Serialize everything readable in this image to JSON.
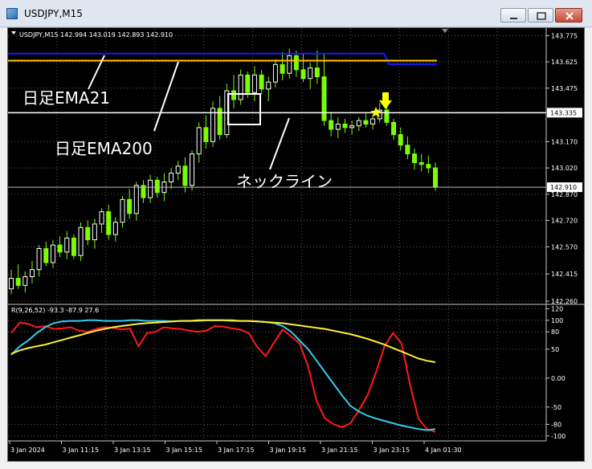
{
  "window": {
    "title": "USDJPY,M15"
  },
  "chart": {
    "header_text": "USDJPY,M15  142.994 143.019 142.893 142.910",
    "price_axis": {
      "labels": [
        "143.775",
        "143.625",
        "143.475",
        "143.170",
        "143.020",
        "142.870",
        "142.720",
        "142.570",
        "142.415",
        "142.260"
      ],
      "values": [
        143.775,
        143.625,
        143.475,
        143.17,
        143.02,
        142.87,
        142.72,
        142.57,
        142.415,
        142.26
      ],
      "range": [
        142.26,
        143.79
      ]
    },
    "neckline_price_label": "143.335",
    "current_price_label": "142.910",
    "annotations": {
      "ema21": "日足EMA21",
      "ema200": "日足EMA200",
      "neckline": "ネックライン"
    },
    "colors": {
      "ema21": "#1a1aff",
      "ema200": "#ffbf00",
      "candle_up": "#ffffff",
      "candle_down": "#7cfc00",
      "neckline": "#ffffff",
      "arrow": "#ffff00"
    },
    "candles": [
      [
        142.33,
        142.44,
        142.3,
        142.39
      ],
      [
        142.39,
        142.47,
        142.33,
        142.35
      ],
      [
        142.35,
        142.43,
        142.31,
        142.4
      ],
      [
        142.4,
        142.49,
        142.36,
        142.44
      ],
      [
        142.44,
        142.58,
        142.4,
        142.56
      ],
      [
        142.56,
        142.6,
        142.46,
        142.48
      ],
      [
        142.48,
        142.61,
        142.45,
        142.58
      ],
      [
        142.58,
        142.63,
        142.51,
        142.54
      ],
      [
        142.54,
        142.66,
        142.5,
        142.62
      ],
      [
        142.62,
        142.64,
        142.5,
        142.52
      ],
      [
        142.52,
        142.71,
        142.49,
        142.68
      ],
      [
        142.68,
        142.72,
        142.58,
        142.61
      ],
      [
        142.61,
        142.73,
        142.56,
        142.7
      ],
      [
        142.7,
        142.79,
        142.65,
        142.77
      ],
      [
        142.77,
        142.81,
        142.61,
        142.64
      ],
      [
        142.64,
        142.74,
        142.6,
        142.71
      ],
      [
        142.71,
        142.86,
        142.68,
        142.84
      ],
      [
        142.84,
        142.9,
        142.73,
        142.76
      ],
      [
        142.76,
        142.94,
        142.72,
        142.92
      ],
      [
        142.92,
        142.95,
        142.82,
        142.85
      ],
      [
        142.85,
        142.98,
        142.82,
        142.95
      ],
      [
        142.95,
        142.97,
        142.85,
        142.88
      ],
      [
        142.88,
        142.99,
        142.83,
        142.94
      ],
      [
        142.94,
        143.02,
        142.9,
        142.99
      ],
      [
        142.99,
        143.06,
        142.95,
        143.03
      ],
      [
        143.03,
        143.08,
        142.88,
        142.92
      ],
      [
        142.92,
        143.12,
        142.89,
        143.1
      ],
      [
        143.1,
        143.28,
        143.05,
        143.25
      ],
      [
        143.25,
        143.32,
        143.13,
        143.17
      ],
      [
        143.17,
        143.4,
        143.14,
        143.36
      ],
      [
        143.36,
        143.43,
        143.18,
        143.21
      ],
      [
        143.21,
        143.5,
        143.19,
        143.46
      ],
      [
        143.46,
        143.55,
        143.36,
        143.41
      ],
      [
        143.41,
        143.58,
        143.38,
        143.55
      ],
      [
        143.55,
        143.57,
        143.42,
        143.45
      ],
      [
        143.45,
        143.6,
        143.4,
        143.55
      ],
      [
        143.55,
        143.58,
        143.44,
        143.47
      ],
      [
        143.47,
        143.54,
        143.4,
        143.51
      ],
      [
        143.51,
        143.64,
        143.48,
        143.61
      ],
      [
        143.61,
        143.68,
        143.52,
        143.56
      ],
      [
        143.56,
        143.7,
        143.53,
        143.66
      ],
      [
        143.66,
        143.69,
        143.54,
        143.58
      ],
      [
        143.58,
        143.67,
        143.51,
        143.53
      ],
      [
        143.53,
        143.62,
        143.47,
        143.59
      ],
      [
        143.59,
        143.69,
        143.5,
        143.54
      ],
      [
        143.54,
        143.67,
        143.26,
        143.29
      ],
      [
        143.29,
        143.34,
        143.2,
        143.24
      ],
      [
        143.24,
        143.31,
        143.19,
        143.27
      ],
      [
        143.27,
        143.3,
        143.22,
        143.25
      ],
      [
        143.25,
        143.29,
        143.21,
        143.26
      ],
      [
        143.26,
        143.31,
        143.23,
        143.29
      ],
      [
        143.29,
        143.33,
        143.25,
        143.27
      ],
      [
        143.27,
        143.31,
        143.24,
        143.3
      ],
      [
        143.3,
        143.39,
        143.28,
        143.35
      ],
      [
        143.35,
        143.37,
        143.26,
        143.28
      ],
      [
        143.28,
        143.3,
        143.18,
        143.21
      ],
      [
        143.21,
        143.25,
        143.12,
        143.15
      ],
      [
        143.15,
        143.2,
        143.07,
        143.1
      ],
      [
        143.1,
        143.13,
        143.01,
        143.05
      ],
      [
        143.05,
        143.1,
        143.0,
        143.04
      ],
      [
        143.04,
        143.09,
        142.99,
        143.02
      ],
      [
        143.02,
        143.05,
        142.89,
        142.91
      ]
    ],
    "ema21_price": 143.672,
    "ema21_after_price": 143.612,
    "ema200_price": 143.632,
    "neckline_price": 143.335,
    "oscillator": {
      "header": "R(9,26,52) -93.3 -87.9 27.6",
      "axis_labels": [
        "120",
        "100",
        "80",
        "50",
        "0.00",
        "-50",
        "-80",
        "-100"
      ],
      "axis_values": [
        120,
        100,
        80,
        50,
        0,
        -50,
        -80,
        -100
      ],
      "range": [
        -103,
        122
      ],
      "series": [
        {
          "name": "red",
          "color": "#ff1a1a",
          "values": [
            78,
            96,
            94,
            88,
            90,
            85,
            86,
            88,
            82,
            80,
            85,
            88,
            87,
            84,
            86,
            55,
            78,
            80,
            88,
            86,
            85,
            82,
            80,
            82,
            90,
            89,
            86,
            84,
            78,
            54,
            38,
            62,
            84,
            72,
            60,
            20,
            -40,
            -70,
            -80,
            -85,
            -78,
            -55,
            -30,
            10,
            55,
            78,
            60,
            -10,
            -70,
            -88,
            -93
          ]
        },
        {
          "name": "cyan",
          "color": "#33ccee",
          "values": [
            40,
            55,
            65,
            78,
            88,
            95,
            98,
            99,
            99,
            100,
            100,
            99,
            99,
            99,
            100,
            100,
            99,
            99,
            99,
            98,
            99,
            99,
            99,
            100,
            100,
            100,
            99,
            99,
            99,
            98,
            97,
            95,
            90,
            80,
            65,
            50,
            30,
            10,
            -10,
            -30,
            -48,
            -58,
            -65,
            -70,
            -74,
            -78,
            -82,
            -85,
            -88,
            -90,
            -88
          ]
        },
        {
          "name": "yellow",
          "color": "#ffee33",
          "values": [
            42,
            48,
            52,
            55,
            58,
            62,
            66,
            70,
            74,
            78,
            82,
            85,
            88,
            90,
            92,
            94,
            95,
            96,
            97,
            98,
            99,
            99,
            100,
            100,
            100,
            100,
            100,
            99,
            99,
            98,
            97,
            96,
            95,
            93,
            91,
            89,
            87,
            85,
            82,
            79,
            76,
            72,
            68,
            63,
            58,
            52,
            46,
            40,
            34,
            30,
            27.6
          ]
        }
      ]
    },
    "time_axis": {
      "labels": [
        "3 Jan 2024",
        "3 Jan 11:15",
        "3 Jan 13:15",
        "3 Jan 15:15",
        "3 Jan 17:15",
        "3 Jan 19:15",
        "3 Jan 21:15",
        "3 Jan 23:15",
        "4 Jan 01:30"
      ]
    }
  }
}
